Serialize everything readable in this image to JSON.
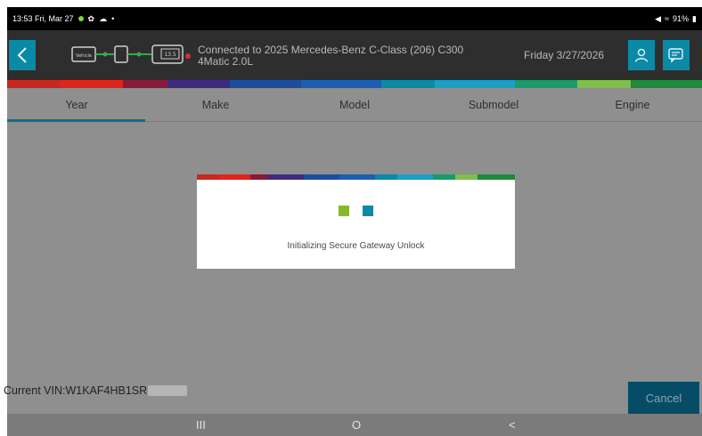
{
  "status_bar": {
    "time_date": "13:53  Fri, Mar 27",
    "battery": "91%",
    "icons": [
      "dot-icon",
      "gear-icon",
      "cloud-icon",
      "bullet-icon",
      "mute-icon",
      "wifi-icon",
      "battery-icon"
    ]
  },
  "header": {
    "connection_text": "Connected to 2025 Mercedes-Benz C-Class (206) C300 4Matic 2.0L",
    "date_text": "Friday 3/27/2026",
    "voltage_label": "13.5",
    "vehicle_label": "Vehicle",
    "icons": [
      "back-chevron-icon",
      "connection-chain-icon",
      "user-icon",
      "chat-icon"
    ],
    "accent_color": "#0a8aa7"
  },
  "tabs": [
    {
      "label": "Year",
      "active": true
    },
    {
      "label": "Make",
      "active": false
    },
    {
      "label": "Model",
      "active": false
    },
    {
      "label": "Submodel",
      "active": false
    },
    {
      "label": "Engine",
      "active": false
    }
  ],
  "vin": {
    "label": "Current VIN:W1KAF4HB1SR"
  },
  "cancel_label": "Cancel",
  "dialog": {
    "message": "Initializing Secure Gateway Unlock",
    "indicator_colors": [
      "#86b92a",
      "#0a8aa7"
    ]
  },
  "nav_bar": {
    "recents": "III",
    "home": "O",
    "back": "<"
  },
  "brand_stripe_colors": [
    "#c8281e",
    "#e2231a",
    "#8a1a3c",
    "#3f2a80",
    "#1d4e9e",
    "#1a5fb4",
    "#0a8aa7",
    "#18a0c9",
    "#1a9a6a",
    "#7fbf4a",
    "#1f8a3c"
  ]
}
